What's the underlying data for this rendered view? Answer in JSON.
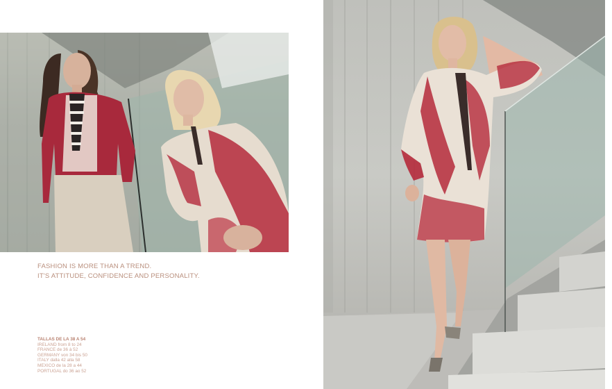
{
  "headline": {
    "line1": "FASHION IS MORE THAN A TREND.",
    "line2": "IT'S ATTITUDE, CONFIDENCE AND PERSONALITY."
  },
  "sizes": {
    "heading": "TALLAS DE LA 38 A 54",
    "lines": [
      "IRELAND from 8 to 24",
      "FRANCE de 36 à 52",
      "GERMANY von 34 bis 50",
      "ITALY dalla 42 alla 58",
      "MEXICO de la 28 a 44",
      "PORTUGAL do 36 ao 52"
    ]
  },
  "colors": {
    "accent_text": "#b98f7d",
    "garment_red": "#b8283a",
    "concrete": "#c5c6c1",
    "glass": "#a8bdb2"
  }
}
